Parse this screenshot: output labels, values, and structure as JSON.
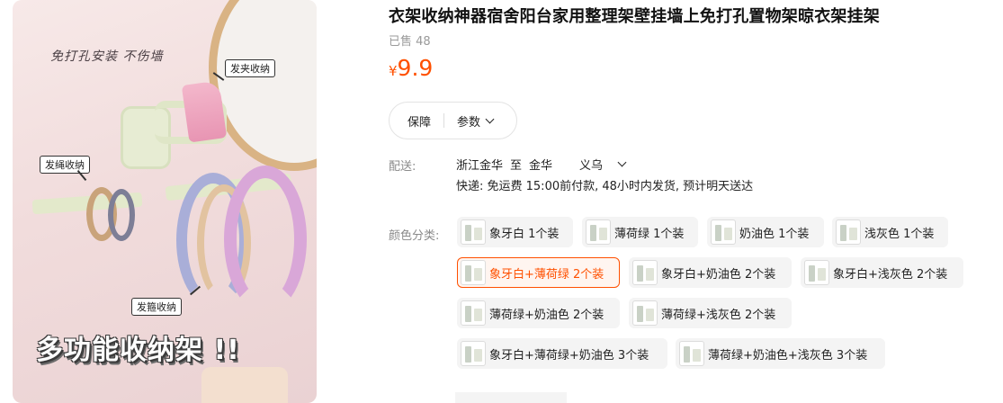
{
  "product": {
    "title": "衣架收纳神器宿舍阳台家用整理架壁挂墙上免打孔置物架晾衣架挂架",
    "sold": "已售 48",
    "price_currency": "¥",
    "price_value": "9.9"
  },
  "image": {
    "slogan": "免打孔安装 不伤墙",
    "label_clip": "发夹收纳",
    "label_rope": "发绳收纳",
    "label_band": "发箍收纳",
    "headline": "多功能收纳架 !!"
  },
  "pill": {
    "guarantee": "保障",
    "params": "参数"
  },
  "shipping": {
    "label": "配送:",
    "from": "浙江金华",
    "to_word": "至",
    "to_city": "金华",
    "to_district": "义乌",
    "detail": "快递: 免运费  15:00前付款, 48小时内发货, 预计明天送达"
  },
  "colors": {
    "label": "颜色分类:",
    "options": [
      {
        "label": "象牙白 1个装",
        "selected": false
      },
      {
        "label": "薄荷绿 1个装",
        "selected": false
      },
      {
        "label": "奶油色 1个装",
        "selected": false
      },
      {
        "label": "浅灰色 1个装",
        "selected": false
      },
      {
        "label": "象牙白+薄荷绿 2个装",
        "selected": true
      },
      {
        "label": "象牙白+奶油色 2个装",
        "selected": false
      },
      {
        "label": "象牙白+浅灰色 2个装",
        "selected": false
      },
      {
        "label": "薄荷绿+奶油色 2个装",
        "selected": false
      },
      {
        "label": "薄荷绿+浅灰色 2个装",
        "selected": false
      },
      {
        "label": "象牙白+薄荷绿+奶油色 3个装",
        "selected": false
      },
      {
        "label": "薄荷绿+奶油色+浅灰色 3个装",
        "selected": false
      }
    ]
  },
  "theme": {
    "accent": "#ff5000",
    "muted": "#8a8a8a",
    "option_bg": "#f4f4f4"
  }
}
